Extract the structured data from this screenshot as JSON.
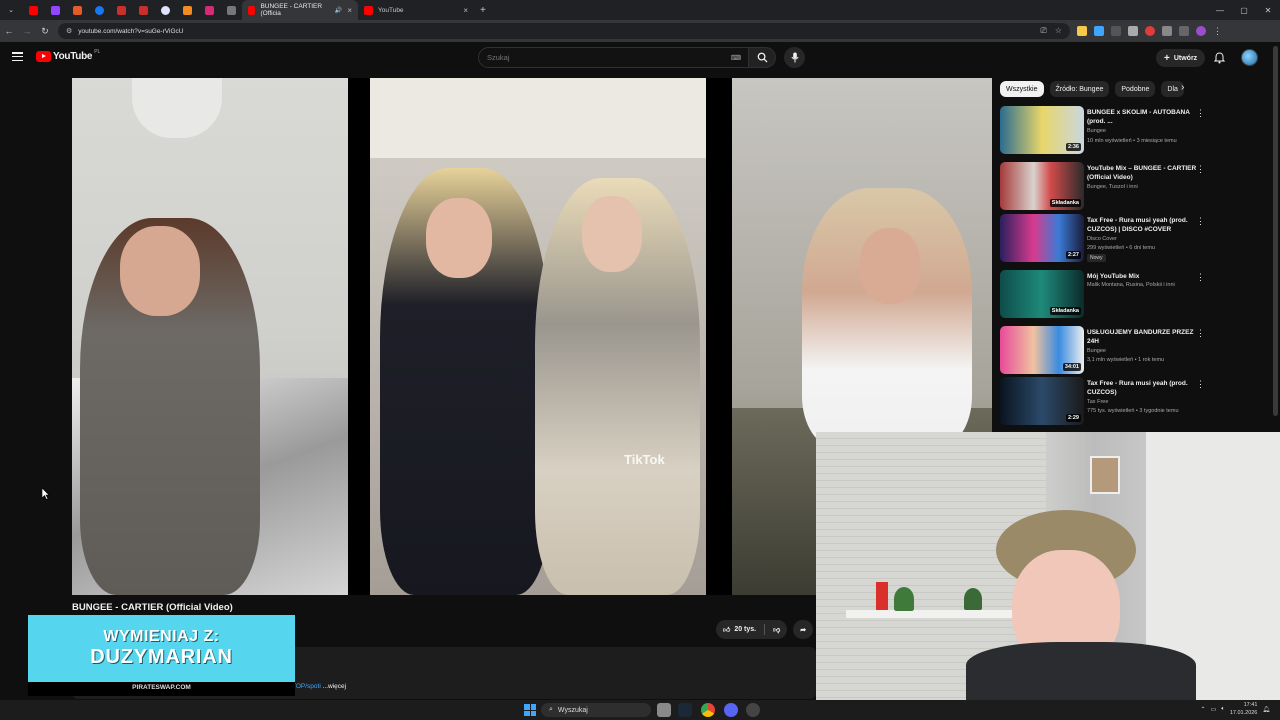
{
  "browser": {
    "tabs": [
      {
        "title": "BUNGEE - CARTIER (Officia",
        "active": true
      },
      {
        "title": "YouTube",
        "active": false
      }
    ],
    "url": "youtube.com/watch?v=suGe-rViGcU"
  },
  "youtube": {
    "logo_text": "YouTube",
    "country_code": "PL",
    "search_placeholder": "Szukaj",
    "create_label": "Utwórz"
  },
  "video": {
    "title": "BUNGEE - CARTIER (Official Video)",
    "likes": "20 tys.",
    "watermark": "TikTok",
    "desc_link": "TOP/spoti",
    "desc_more": "...więcej"
  },
  "banner": {
    "line1": "WYMIENIAJ Z:",
    "line2": "DUZYMARIAN",
    "site": "PIRATESWAP.COM"
  },
  "chips": [
    "Wszystkie",
    "Źródło: Bungee",
    "Podobne",
    "Dla"
  ],
  "recommendations": [
    {
      "title": "BUNGEE x SKOLIM - AUTOBANA (prod. ...",
      "channel": "Bungee",
      "meta": "10 mln wyświetleń • 3 miesiące temu",
      "duration": "2:36",
      "badge": ""
    },
    {
      "title": "YouTube Mix – BUNGEE - CARTIER (Official Video)",
      "channel": "Bungee, Tuszol i inni",
      "meta": "",
      "duration": "Składanka",
      "badge": ""
    },
    {
      "title": "Tax Free - Rura musi yeah (prod. CUZCOS) | DISCO #COVER",
      "channel": "Disco Cover",
      "meta": "299 wyświetleń • 6 dni temu",
      "duration": "2:27",
      "badge": "Nowy"
    },
    {
      "title": "Mój YouTube Mix",
      "channel": "Malik Montana, Rusina, Polskii i inni",
      "meta": "",
      "duration": "Składanka",
      "badge": ""
    },
    {
      "title": "USŁUGUJEMY BANDURZE PRZEZ 24H",
      "channel": "Bungee",
      "meta": "3,1 mln wyświetleń • 1 rok temu",
      "duration": "34:01",
      "badge": ""
    },
    {
      "title": "Tax Free - Rura musi yeah (prod. CUZCOS)",
      "channel": "Tax Free",
      "meta": "775 tys. wyświetleń • 3 tygodnie temu",
      "duration": "2:29",
      "badge": ""
    }
  ],
  "taskbar": {
    "search_label": "Wyszukaj",
    "time": "17:41",
    "date": "17.01.2026"
  },
  "colors": {
    "yt_red": "#ff0000",
    "banner_cyan": "#55d6ee",
    "background": "#0f0f0f"
  }
}
